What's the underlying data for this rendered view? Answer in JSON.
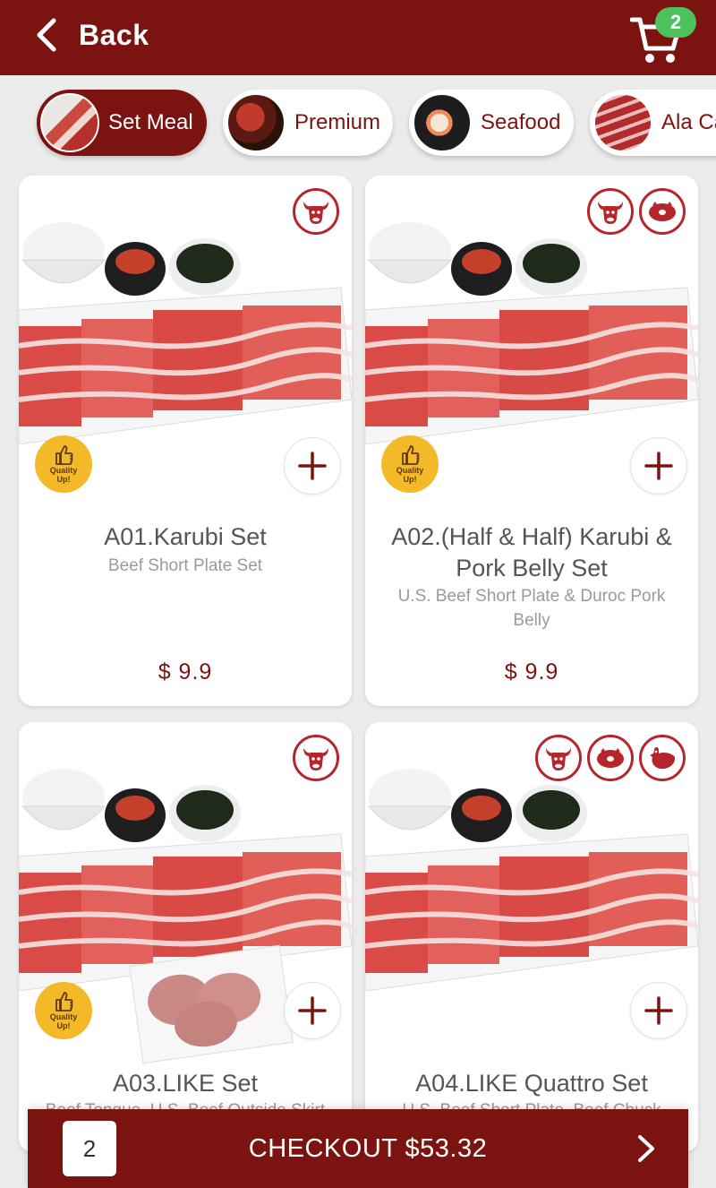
{
  "header": {
    "back_label": "Back",
    "cart_count": "2"
  },
  "categories": [
    {
      "label": "Set Meal",
      "active": true
    },
    {
      "label": "Premium",
      "active": false
    },
    {
      "label": "Seafood",
      "active": false
    },
    {
      "label": "Ala Carte",
      "active": false
    }
  ],
  "products": [
    {
      "title": "A01.Karubi Set",
      "subtitle": "Beef Short Plate Set",
      "price": "$ 9.9",
      "tags": [
        "beef-icon"
      ],
      "quality_badge": "Quality Up!"
    },
    {
      "title": "A02.(Half & Half) Karubi & Pork Belly Set",
      "subtitle": "U.S. Beef Short Plate & Duroc Pork Belly",
      "price": "$ 9.9",
      "tags": [
        "beef-icon",
        "pork-icon"
      ],
      "quality_badge": "Quality Up!"
    },
    {
      "title": "A03.LIKE Set",
      "subtitle": "Beef Tongue, U.S. Beef Outside Skirt",
      "tags": [
        "beef-icon"
      ],
      "quality_badge": "Quality Up!"
    },
    {
      "title": "A04.LIKE Quattro Set",
      "subtitle": "U.S. Beef Short Plate, Beef Chuck",
      "tags": [
        "beef-icon",
        "pork-icon",
        "chicken-icon"
      ]
    }
  ],
  "checkout": {
    "count": "2",
    "label": "CHECKOUT $53.32"
  },
  "colors": {
    "brand": "#7b1310",
    "tag_outline": "#b6252b",
    "badge_green": "#4cc15c",
    "quality_yellow": "#f3b928"
  }
}
